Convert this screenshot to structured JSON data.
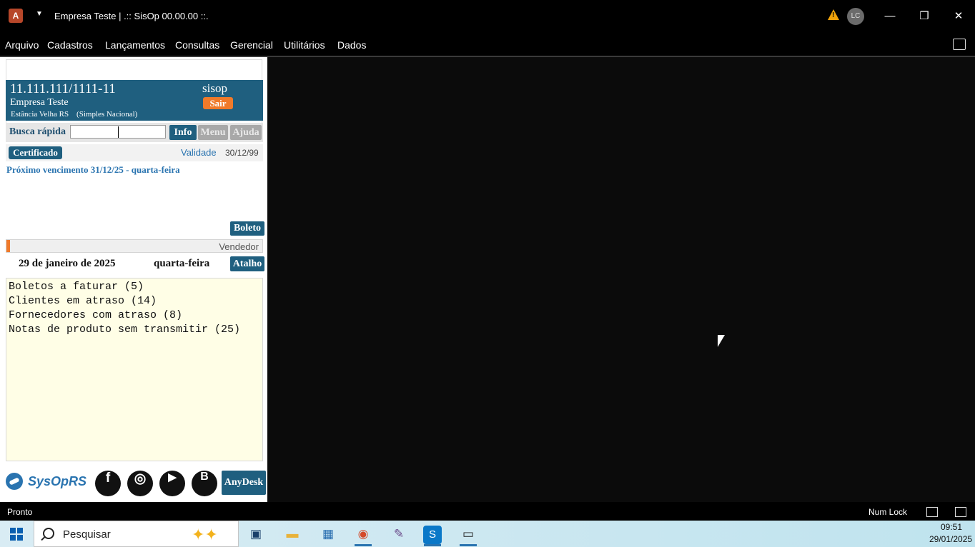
{
  "window": {
    "app_icon": "A",
    "title": "Empresa Teste | .:: SisOp 00.00.00 ::.",
    "user_initials": "LC",
    "minimize_label": "—",
    "maximize_label": "❐",
    "close_label": "✕"
  },
  "menu": {
    "items": [
      "Arquivo",
      "Cadastros",
      "Lançamentos",
      "Consultas",
      "Gerencial",
      "Utilitários",
      "Dados"
    ]
  },
  "company": {
    "cnpj": "11.111.111/1111-11",
    "name": "Empresa Teste",
    "location": "Estância Velha RS    (Simples Nacional)",
    "user": "sisop",
    "logout_label": "Sair"
  },
  "search": {
    "label": "Busca rápida",
    "value": "",
    "info_label": "Info",
    "menu_label": "Menu",
    "help_label": "Ajuda"
  },
  "certificate": {
    "button_label": "Certificado",
    "validity_label": "Validade",
    "validity_date": "30/12/99"
  },
  "billing": {
    "next_due": "Próximo vencimento 31/12/25 - quarta-feira",
    "boleto_label": "Boleto"
  },
  "seller": {
    "label": "Vendedor"
  },
  "today": {
    "date": "29 de janeiro de 2025",
    "weekday": "quarta-feira",
    "shortcut_label": "Atalho"
  },
  "notes": [
    "Boletos a faturar (5)",
    "Clientes em atraso (14)",
    "Fornecedores com atraso (8)",
    "Notas de produto sem transmitir (25)"
  ],
  "footer": {
    "brand": "SysOpRS",
    "facebook": "f",
    "instagram": "◎",
    "youtube": "▶",
    "blog": "B",
    "anydesk_label": "AnyDesk"
  },
  "statusbar": {
    "status": "Pronto",
    "numlock": "Num Lock"
  },
  "taskbar": {
    "search_placeholder": "Pesquisar",
    "time": "09:51",
    "date": "29/01/2025"
  },
  "colors": {
    "accent_blue": "#1f5f7f",
    "accent_orange": "#f07a2a",
    "link_blue": "#2a74b0"
  }
}
